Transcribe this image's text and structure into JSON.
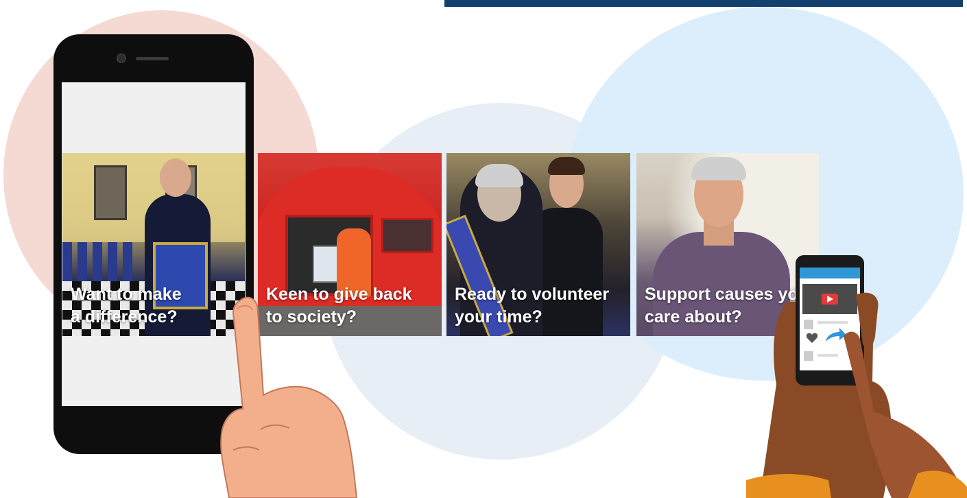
{
  "cards": [
    {
      "line1": "Want to make",
      "line2": "a difference?"
    },
    {
      "line1": "Keen to give back",
      "line2": "to society?"
    },
    {
      "line1": "Ready to volunteer",
      "line2": "your time?"
    },
    {
      "line1": "Support causes you",
      "line2": "care about?"
    }
  ],
  "colors": {
    "top_bar": "#123f6e",
    "circle_pink": "#f5d9d3",
    "circle_blue": "#dceefb",
    "circle_grey": "#e7eef5"
  }
}
